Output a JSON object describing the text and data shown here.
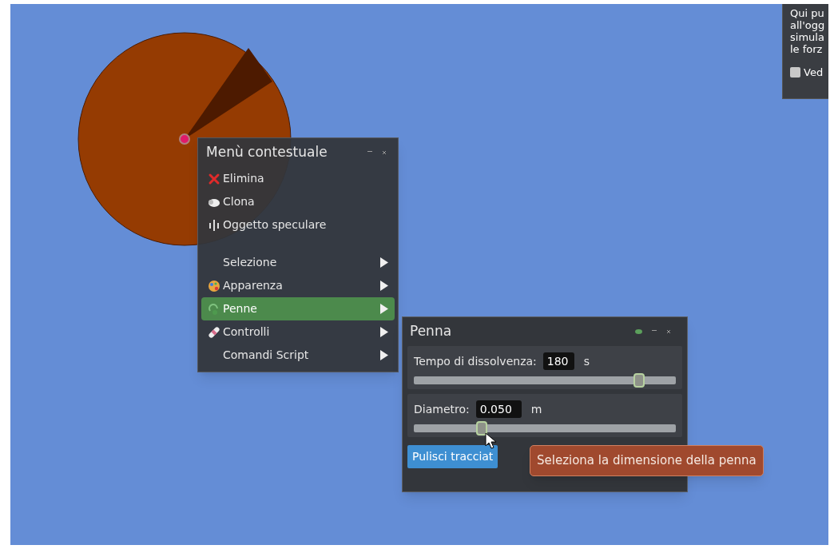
{
  "info_panel": {
    "lines": [
      "Qui pu",
      "all'ogg",
      "simula",
      "le forz"
    ],
    "checkbox": {
      "label": "Ved",
      "checked": false
    }
  },
  "context_menu": {
    "title": "Menù contestuale",
    "items": [
      {
        "label": "Elimina",
        "selected": false,
        "submenu": false
      },
      {
        "label": "Clona",
        "selected": false,
        "submenu": false
      },
      {
        "label": "Oggetto speculare",
        "selected": false,
        "submenu": false
      },
      {
        "label": "Selezione",
        "selected": false,
        "submenu": true
      },
      {
        "label": "Apparenza",
        "selected": false,
        "submenu": true
      },
      {
        "label": "Penne",
        "selected": true,
        "submenu": true
      },
      {
        "label": "Controlli",
        "selected": false,
        "submenu": true
      },
      {
        "label": "Comandi Script",
        "selected": false,
        "submenu": true
      }
    ]
  },
  "pen_window": {
    "title": "Penna",
    "rows": [
      {
        "label": "Tempo di dissolvenza:",
        "value": "180",
        "unit": "s",
        "level": 0.86
      },
      {
        "label": "Diametro:",
        "value": "0.050",
        "unit": "m",
        "level": 0.26
      }
    ],
    "button": "Pulisci tracciat"
  },
  "tooltip": "Seleziona la dimensione della penna"
}
